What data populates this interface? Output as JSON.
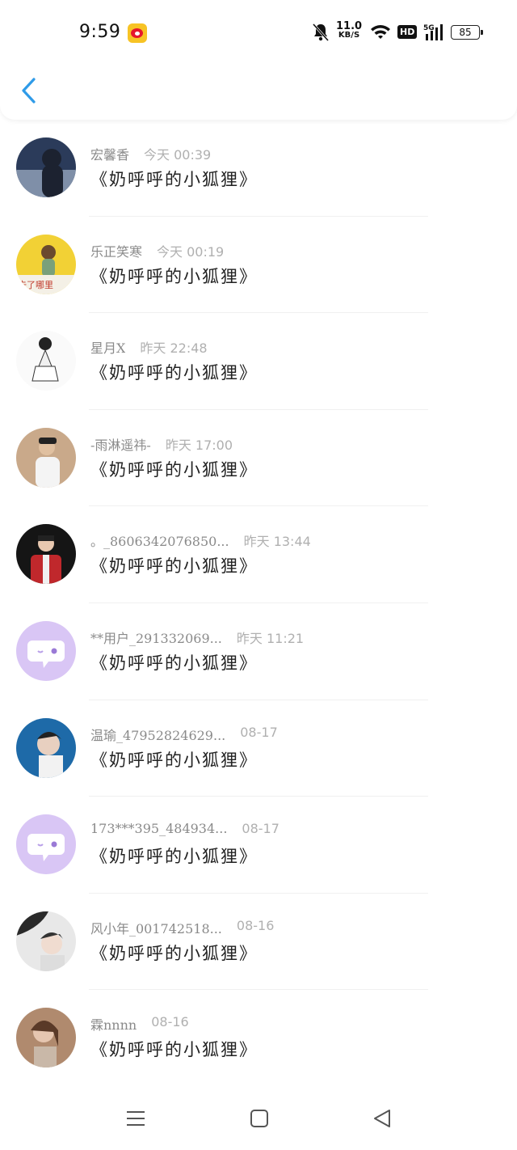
{
  "status_bar": {
    "time": "9:59",
    "net_speed_value": "11.0",
    "net_speed_unit": "KB/S",
    "hd_label": "HD",
    "signal_label": "5G",
    "battery": "85"
  },
  "header": {
    "back_icon": "chevron-left-icon",
    "accent": "#2f9be8"
  },
  "items": [
    {
      "name": "宏馨香",
      "time": "今天 00:39",
      "message": "《奶呼呼的小狐狸》",
      "avatar_color": "#3a4a6a"
    },
    {
      "name": "乐正笑寒",
      "time": "今天 00:19",
      "message": "《奶呼呼的小狐狸》",
      "avatar_color": "#f2d135"
    },
    {
      "name": "星月X",
      "time": "昨天 22:48",
      "message": "《奶呼呼的小狐狸》",
      "avatar_color": "#ffffff"
    },
    {
      "name": "-雨淋遥祎-",
      "time": "昨天 17:00",
      "message": "《奶呼呼的小狐狸》",
      "avatar_color": "#c9a98a"
    },
    {
      "name": "。_8606342076850...",
      "time": "昨天 13:44",
      "message": "《奶呼呼的小狐狸》",
      "avatar_color": "#1a1a1a"
    },
    {
      "name": "**用户_291332069...",
      "time": "昨天 11:21",
      "message": "《奶呼呼的小狐狸》",
      "avatar_color": "#d9c6f5"
    },
    {
      "name": "温瑜_47952824629...",
      "time": "08-17",
      "message": "《奶呼呼的小狐狸》",
      "avatar_color": "#1e6aa8"
    },
    {
      "name": "173***395_484934...",
      "time": "08-17",
      "message": "《奶呼呼的小狐狸》",
      "avatar_color": "#d9c6f5"
    },
    {
      "name": "风小年_001742518...",
      "time": "08-16",
      "message": "《奶呼呼的小狐狸》",
      "avatar_color": "#6b6b6b"
    },
    {
      "name": "霖nnnn",
      "time": "08-16",
      "message": "《奶呼呼的小狐狸》",
      "avatar_color": "#b08a6e"
    }
  ],
  "nav": {
    "menu_icon": "menu-icon",
    "home_icon": "home-square-icon",
    "back_icon": "back-triangle-icon"
  }
}
